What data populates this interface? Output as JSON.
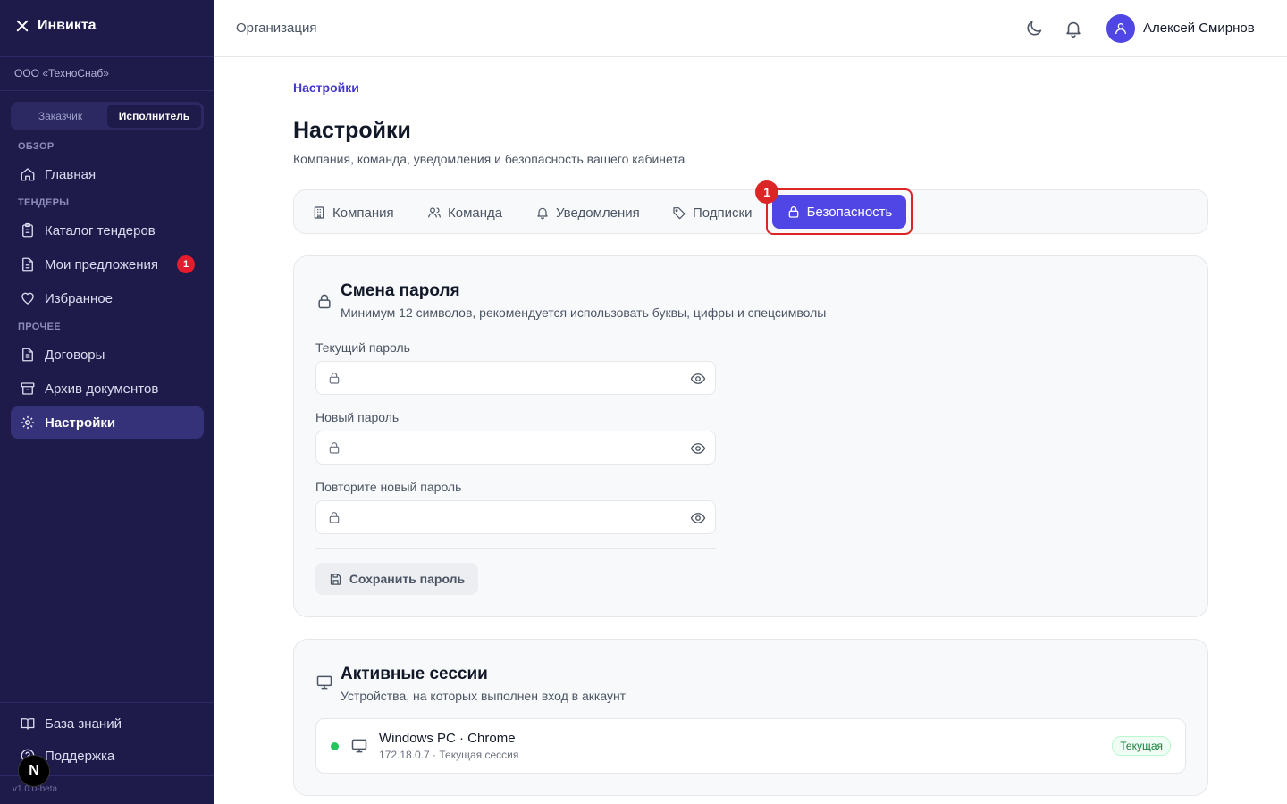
{
  "app": {
    "brand": "Инвикта",
    "org": "ООО «ТехноСнаб»",
    "version": "v1.0.0-beta"
  },
  "role_switch": {
    "options": [
      "Заказчик",
      "Исполнитель"
    ],
    "active": "Исполнитель"
  },
  "sidebar": {
    "sections": [
      "ОБЗОР",
      "ТЕНДЕРЫ",
      "ПРОЧЕЕ"
    ],
    "items": [
      {
        "label": "Главная",
        "icon": "home-icon"
      },
      {
        "label": "Каталог тендеров",
        "icon": "clipboard-icon"
      },
      {
        "label": "Мои предложения",
        "icon": "file-icon",
        "badge": "1"
      },
      {
        "label": "Избранное",
        "icon": "heart-icon"
      },
      {
        "label": "Договоры",
        "icon": "document-icon"
      },
      {
        "label": "Архив документов",
        "icon": "archive-icon"
      },
      {
        "label": "Настройки",
        "icon": "gear-icon",
        "active": true
      }
    ],
    "bottom": [
      {
        "label": "База знаний",
        "icon": "book-icon"
      },
      {
        "label": "Поддержка",
        "icon": "help-icon"
      }
    ]
  },
  "header": {
    "title": "Организация",
    "user": "Алексей Смирнов"
  },
  "page": {
    "breadcrumb": "Настройки",
    "title": "Настройки",
    "subtitle": "Компания, команда, уведомления и безопасность вашего кабинета"
  },
  "tabs": [
    {
      "label": "Компания",
      "icon": "building-icon"
    },
    {
      "label": "Команда",
      "icon": "users-icon"
    },
    {
      "label": "Уведомления",
      "icon": "bell-icon"
    },
    {
      "label": "Подписки",
      "icon": "tag-icon"
    },
    {
      "label": "Безопасность",
      "icon": "lock-icon",
      "active": true
    }
  ],
  "annotation_marker": "1",
  "password_card": {
    "title": "Смена пароля",
    "subtitle": "Минимум 12 символов, рекомендуется использовать буквы, цифры и спецсимволы",
    "fields": [
      {
        "label": "Текущий пароль",
        "value": ""
      },
      {
        "label": "Новый пароль",
        "value": ""
      },
      {
        "label": "Повторите новый пароль",
        "value": ""
      }
    ],
    "save_label": "Сохранить пароль"
  },
  "sessions_card": {
    "title": "Активные сессии",
    "subtitle": "Устройства, на которых выполнен вход в аккаунт",
    "sessions": [
      {
        "device": "Windows PC · Chrome",
        "details": "172.18.0.7 · Текущая сессия",
        "badge": "Текущая",
        "online": true
      }
    ]
  },
  "colors": {
    "sidebar_bg": "#1e1b4b",
    "accent": "#4f46e5",
    "highlight": "#dc2626",
    "online": "#22c55e"
  }
}
